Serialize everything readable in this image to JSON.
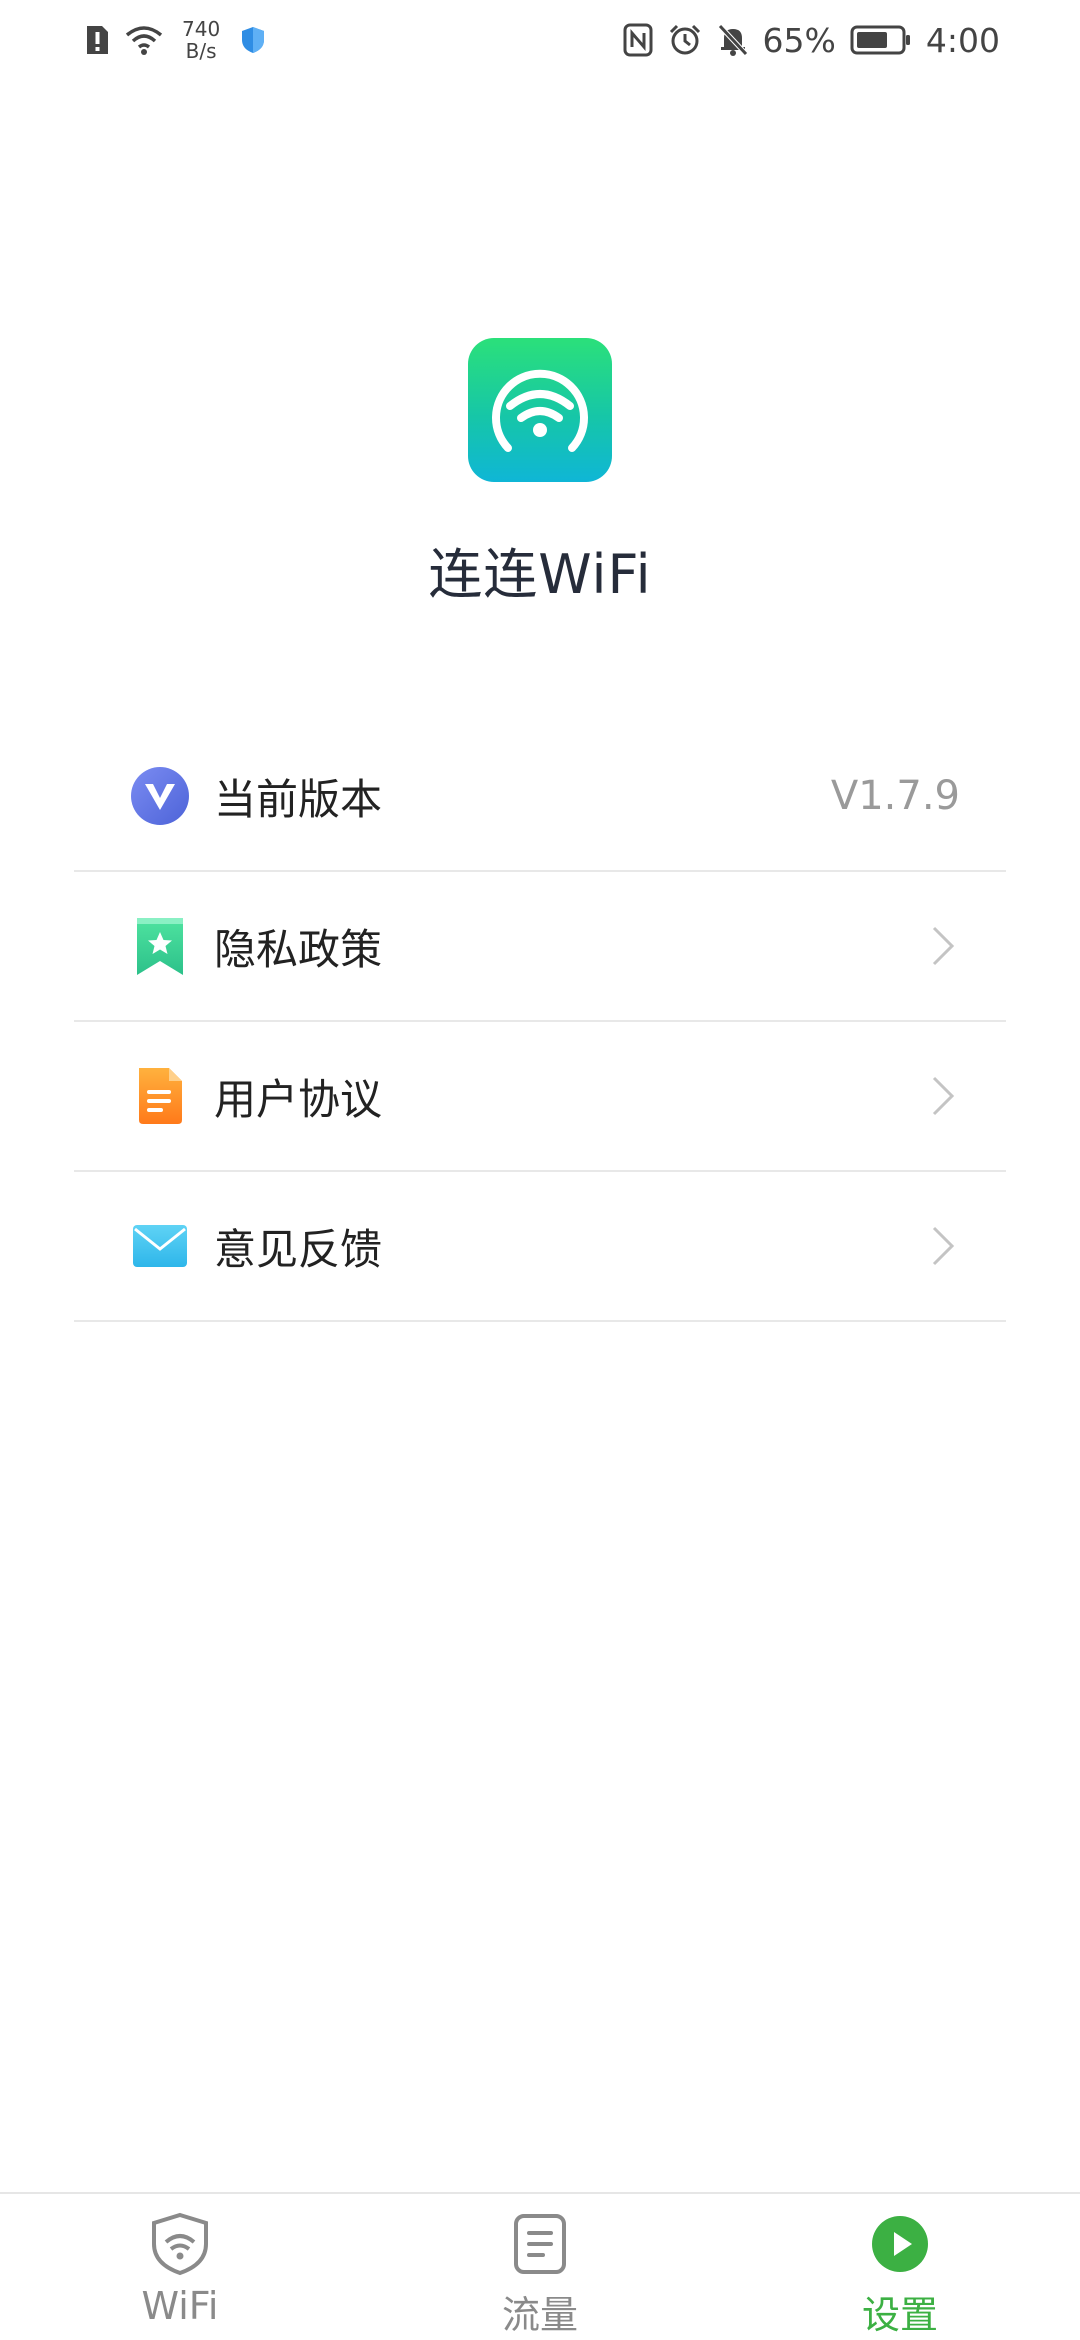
{
  "status_bar": {
    "net_speed_value": "740",
    "net_speed_unit": "B/s",
    "battery": "65%",
    "time": "4:00",
    "icons": [
      "alert-sim-icon",
      "wifi-icon",
      "shield-icon",
      "nfc-icon",
      "alarm-icon",
      "silent-bell-icon",
      "battery-icon"
    ]
  },
  "app": {
    "name": "连连WiFi",
    "logo_icon": "wifi-logo-icon"
  },
  "settings": {
    "items": [
      {
        "label": "当前版本",
        "value": "V1.7.9",
        "icon": "version-v-icon"
      },
      {
        "label": "隐私政策",
        "icon": "bookmark-star-icon"
      },
      {
        "label": "用户协议",
        "icon": "document-icon"
      },
      {
        "label": "意见反馈",
        "icon": "mail-icon"
      }
    ]
  },
  "bottom_nav": {
    "tabs": [
      {
        "label": "WiFi",
        "icon": "wifi-shield-icon",
        "active": false
      },
      {
        "label": "流量",
        "icon": "traffic-doc-icon",
        "active": false
      },
      {
        "label": "设置",
        "icon": "play-circle-icon",
        "active": true
      }
    ]
  },
  "colors": {
    "accent": "#3cb043",
    "logo_gradient_top": "#2be07a",
    "logo_gradient_bottom": "#0fb6d6"
  }
}
